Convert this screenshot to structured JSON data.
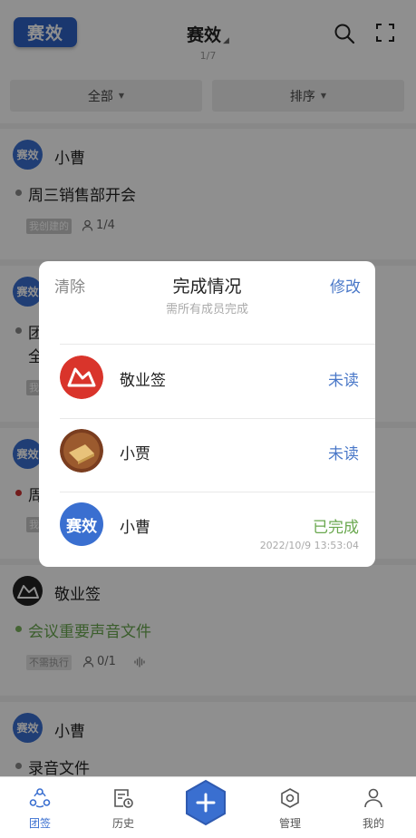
{
  "header": {
    "logo_text": "赛效",
    "title": "赛效",
    "page_indicator": "1/7"
  },
  "filters": {
    "all_label": "全部",
    "sort_label": "排序"
  },
  "tasks": [
    {
      "user": "小曹",
      "avatar_text": "赛效",
      "title": "周三销售部开会",
      "tag": "我创建的",
      "count": "1/4"
    },
    {
      "user": "",
      "avatar_text": "赛效",
      "title_line1": "团",
      "title_line2": "全",
      "tag": "我"
    },
    {
      "user": "",
      "avatar_text": "赛效",
      "title": "周",
      "tag": "我"
    },
    {
      "user": "敬业签",
      "title": "会议重要声音文件",
      "tag": "不需执行",
      "count": "0/1"
    },
    {
      "user": "小曹",
      "avatar_text": "赛效",
      "title": "录音文件"
    }
  ],
  "dialog": {
    "clear_label": "清除",
    "title": "完成情况",
    "subtitle": "需所有成员完成",
    "edit_label": "修改",
    "members": [
      {
        "name": "敬业签",
        "status": "未读"
      },
      {
        "name": "小贾",
        "status": "未读"
      },
      {
        "name": "小曹",
        "avatar_text": "赛效",
        "status": "已完成",
        "time": "2022/10/9 13:53:04"
      }
    ]
  },
  "nav": {
    "items": [
      {
        "label": "团签"
      },
      {
        "label": "历史"
      },
      {
        "label": "管理"
      },
      {
        "label": "我的"
      }
    ]
  },
  "colors": {
    "accent": "#3a6fd0",
    "link": "#4a78c8",
    "done": "#6aa84f"
  }
}
